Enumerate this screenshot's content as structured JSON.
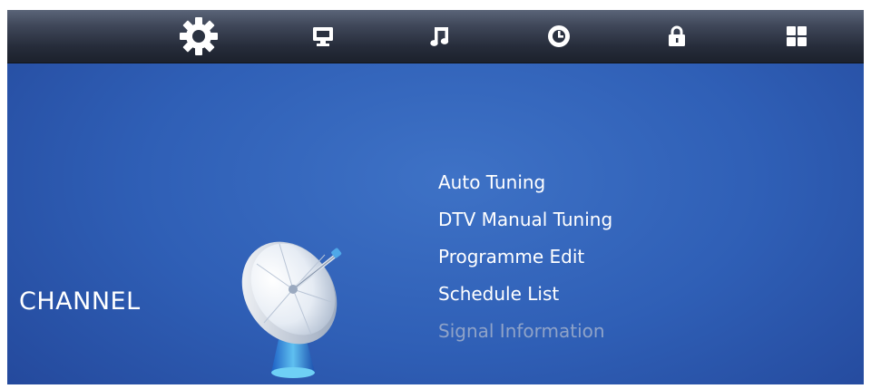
{
  "topbar": {
    "icons": [
      {
        "name": "settings-gear-icon",
        "selected": true
      },
      {
        "name": "monitor-icon",
        "selected": false
      },
      {
        "name": "music-note-icon",
        "selected": false
      },
      {
        "name": "clock-icon",
        "selected": false
      },
      {
        "name": "lock-icon",
        "selected": false
      },
      {
        "name": "apps-grid-icon",
        "selected": false
      }
    ]
  },
  "section": {
    "title": "CHANNEL",
    "icon": "satellite-dish-icon"
  },
  "menu": {
    "items": [
      {
        "label": "Auto Tuning",
        "enabled": true
      },
      {
        "label": "DTV Manual Tuning",
        "enabled": true
      },
      {
        "label": "Programme Edit",
        "enabled": true
      },
      {
        "label": "Schedule List",
        "enabled": true
      },
      {
        "label": "Signal Information",
        "enabled": false
      }
    ]
  },
  "colors": {
    "text": "#ffffff",
    "disabled_text": "#8fa3c8",
    "background": "#2f5fb6",
    "topbar": "#262c3a"
  }
}
